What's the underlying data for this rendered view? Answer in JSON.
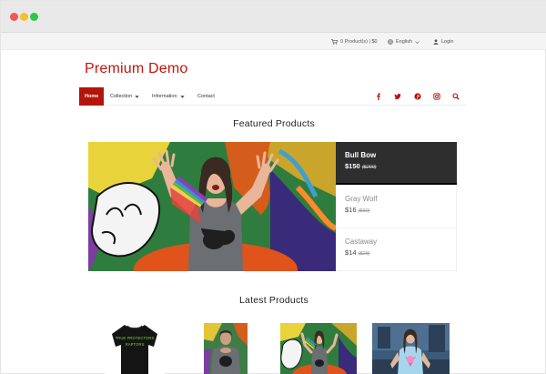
{
  "topbar": {
    "cart": "0 Product(s) | $0",
    "language": "English",
    "login": "Login"
  },
  "store": {
    "name": "Premium Demo"
  },
  "nav": {
    "items": [
      {
        "label": "Home",
        "active": true
      },
      {
        "label": "Collection",
        "dropdown": true
      },
      {
        "label": "Information",
        "dropdown": true
      },
      {
        "label": "Contact"
      }
    ],
    "icons": [
      "facebook-icon",
      "twitter-icon",
      "pinterest-icon",
      "instagram-icon",
      "search-icon"
    ]
  },
  "featured": {
    "title": "Featured Products",
    "products": [
      {
        "name": "Bull Bow",
        "price": "$150",
        "old_price": "($200)",
        "active": true
      },
      {
        "name": "Gray Wolf",
        "price": "$16",
        "old_price": "($32)"
      },
      {
        "name": "Castaway",
        "price": "$14",
        "old_price": "($28)"
      }
    ]
  },
  "latest": {
    "title": "Latest Products",
    "shirt_text": [
      "TRUE PROTECTORS",
      "RAPTORS"
    ]
  },
  "colors": {
    "brand": "#c0150b",
    "nav_active": "#b3150b",
    "featured_active_bg": "#2e2e2e"
  }
}
